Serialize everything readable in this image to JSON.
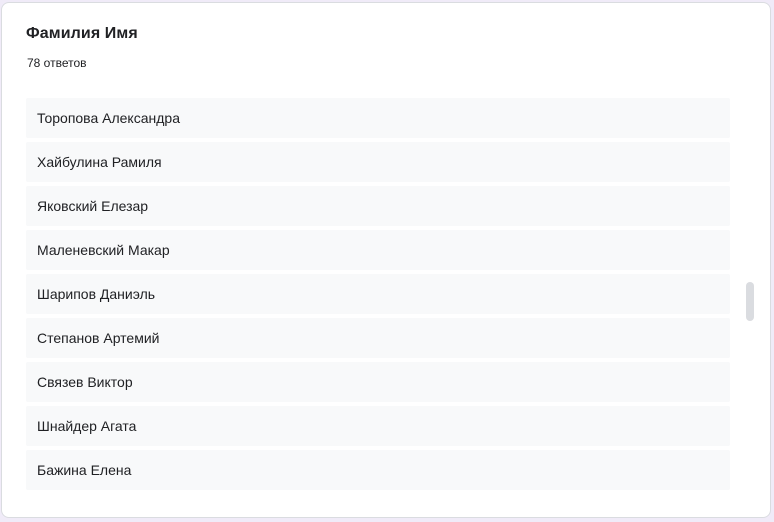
{
  "question": {
    "title": "Фамилия Имя",
    "response_count": "78 ответов"
  },
  "responses": [
    "Торопова Александра",
    "Хайбулина Рамиля",
    "Яковский Елезар",
    "Маленевский Макар",
    "Шарипов Даниэль",
    "Степанов Артемий",
    "Связев Виктор",
    "Шнайдер Агата",
    "Бажина Елена"
  ]
}
